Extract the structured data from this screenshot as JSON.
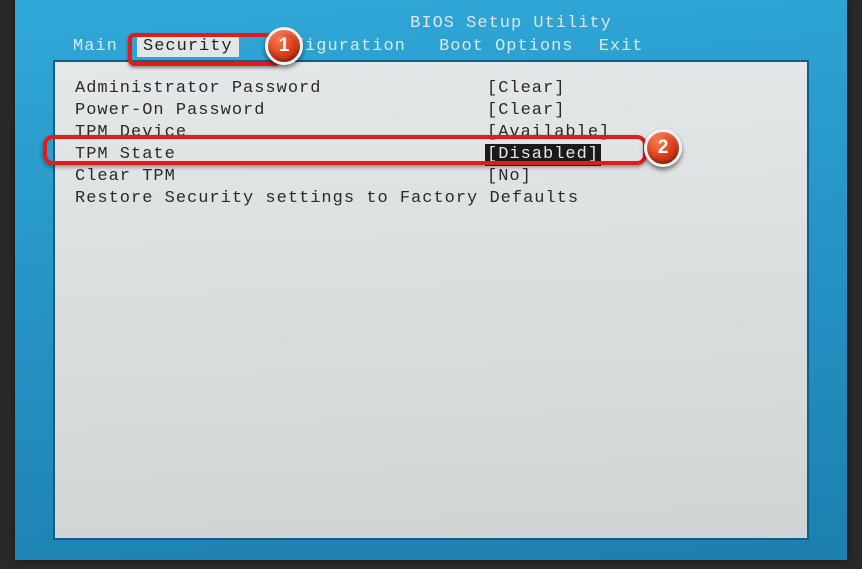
{
  "title": "BIOS Setup Utility",
  "menu": {
    "main": "Main",
    "security": "Security",
    "system_configuration_suffix": "figuration",
    "boot_options": "Boot Options",
    "exit": "Exit"
  },
  "rows": {
    "admin_password": {
      "label": "Administrator Password",
      "value": "[Clear]"
    },
    "poweron_password": {
      "label": "Power-On Password",
      "value": "[Clear]"
    },
    "tpm_device": {
      "label": "TPM Device",
      "value": "[Available]"
    },
    "tpm_state": {
      "label": "TPM State",
      "value": "[Disabled]"
    },
    "clear_tpm": {
      "label": "Clear TPM",
      "value": "[No]"
    },
    "restore_defaults": {
      "label": "Restore Security settings to Factory Defaults"
    }
  },
  "annotations": {
    "badge1": "1",
    "badge2": "2"
  }
}
